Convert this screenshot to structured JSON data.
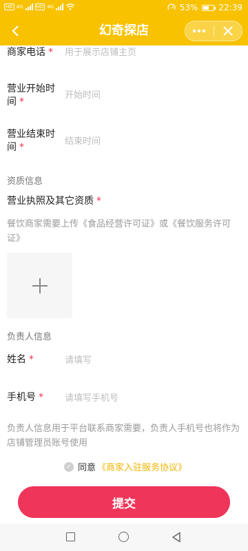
{
  "status_bar": {
    "sim1": "HD",
    "sim2": "HD",
    "network_1": "4G",
    "network_2": "4G",
    "battery_percent": "53%",
    "battery_level": 0.53,
    "time": "22:39"
  },
  "header": {
    "back_icon": "chevron-left-icon",
    "title": "幻奇探店",
    "more_icon": "more-dots-icon",
    "close_icon": "close-icon",
    "background_color": "#f8c200"
  },
  "form": {
    "phone": {
      "label": "商家电话",
      "placeholder": "用于展示店铺主页",
      "value": ""
    },
    "open_time": {
      "label": "营业开始时间",
      "placeholder": "开始时间",
      "value": ""
    },
    "close_time": {
      "label": "营业结束时间",
      "placeholder": "结束时间",
      "value": ""
    },
    "qualification_section": "资质信息",
    "license": {
      "label": "营业执照及其它资质",
      "note": "餐饮商家需要上传《食品经营许可证》或《餐饮服务许可证》"
    },
    "contact_section": "负责人信息",
    "name": {
      "label": "姓名",
      "placeholder": "请填写",
      "value": ""
    },
    "mobile": {
      "label": "手机号",
      "placeholder": "请填写手机号",
      "value": ""
    },
    "contact_note": "负责人信息用于平台联系商家需要，负责人手机号也将作为店铺管理员账号使用",
    "required_mark": "*"
  },
  "agreement": {
    "text": "同意",
    "link": "《商家入驻服务协议》",
    "checked": true
  },
  "submit": {
    "label": "提交",
    "color": "#f0355b"
  },
  "nav": {
    "recent_icon": "square-icon",
    "home_icon": "circle-icon",
    "back_icon": "triangle-back-icon"
  }
}
